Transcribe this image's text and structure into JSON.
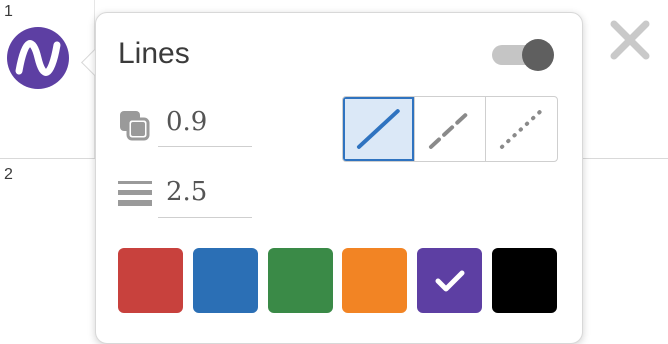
{
  "rows": [
    {
      "number": "1"
    },
    {
      "number": "2"
    }
  ],
  "expression_icon": {
    "name": "desmos-wave-icon",
    "color": "#5d3fa3"
  },
  "close_icon": {
    "name": "close-icon"
  },
  "popup": {
    "title": "Lines",
    "toggle": {
      "state": "on"
    },
    "opacity": {
      "icon": "opacity-icon",
      "value": "0.9"
    },
    "width": {
      "icon": "line-width-icon",
      "value": "2.5"
    },
    "line_styles": [
      {
        "name": "solid",
        "selected": true
      },
      {
        "name": "dashed",
        "selected": false
      },
      {
        "name": "dotted",
        "selected": false
      }
    ],
    "colors": [
      {
        "name": "red",
        "hex": "#c8413d",
        "selected": false
      },
      {
        "name": "blue",
        "hex": "#2b6fb5",
        "selected": false
      },
      {
        "name": "green",
        "hex": "#3a8a47",
        "selected": false
      },
      {
        "name": "orange",
        "hex": "#f28424",
        "selected": false
      },
      {
        "name": "purple",
        "hex": "#5d3fa3",
        "selected": true
      },
      {
        "name": "black",
        "hex": "#000000",
        "selected": false
      }
    ]
  }
}
